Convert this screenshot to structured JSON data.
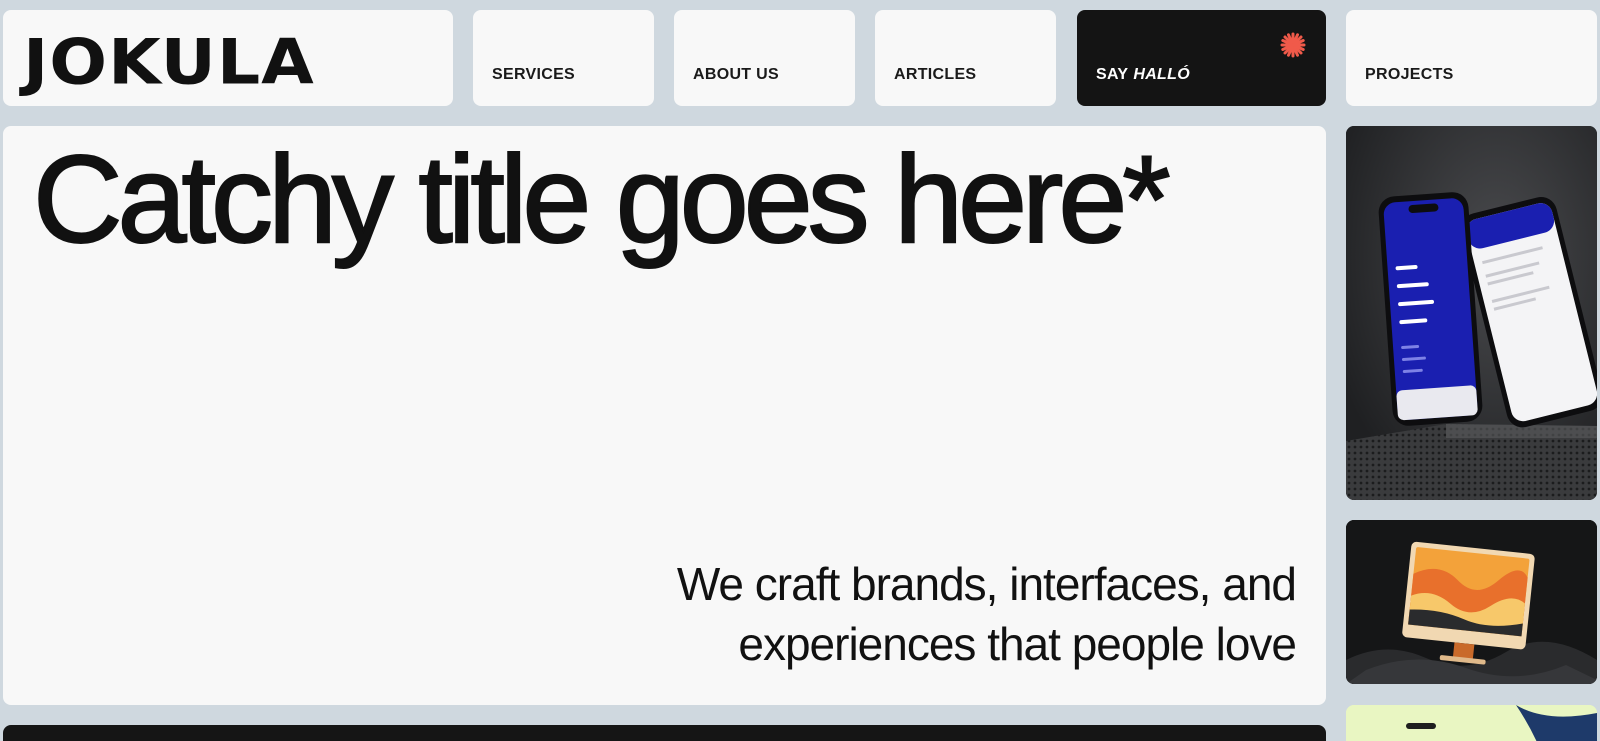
{
  "brand": {
    "logo_text": "JOKULA"
  },
  "nav": {
    "services": "SERVICES",
    "about": "ABOUT US",
    "articles": "ARTICLES",
    "say": "SAY",
    "hallo": "HALLÓ",
    "projects": "PROJECTS"
  },
  "hero": {
    "title": "Catchy title goes here*",
    "tagline_line1": "We craft brands, interfaces, and",
    "tagline_line2": "experiences that people love"
  },
  "colors": {
    "page_background": "#cfd8df",
    "card_background": "#f8f8f8",
    "dark": "#141414",
    "accent": "#f05a4a",
    "phone_screen": "#1a1fb0"
  },
  "icons": {
    "hallo_accent": "asterisk-icon"
  }
}
